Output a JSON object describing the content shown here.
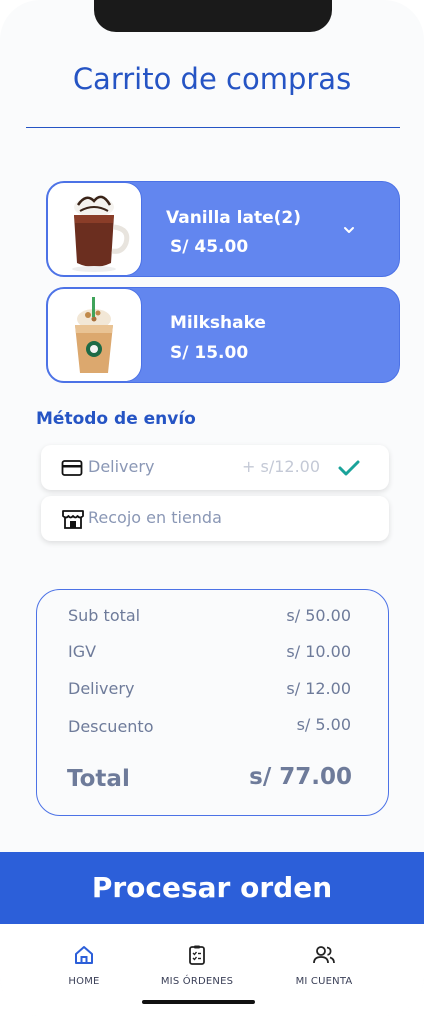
{
  "header": {
    "title": "Carrito de compras"
  },
  "cart": {
    "items": [
      {
        "name": "Vanilla late(2)",
        "price": "S/ 45.00",
        "icon": "hot-chocolate-mug-image"
      },
      {
        "name": "Milkshake",
        "price": "S/ 15.00",
        "icon": "frappuccino-cup-image"
      }
    ]
  },
  "shipping": {
    "label": "Método  de envío",
    "options": [
      {
        "label": "Delivery",
        "cost": "+ s/12.00",
        "icon": "credit-card-icon",
        "selected": true
      },
      {
        "label": "Recojo en tienda",
        "icon": "store-icon",
        "selected": false
      }
    ]
  },
  "summary": {
    "rows": [
      {
        "label": "Sub total",
        "value": "s/ 50.00"
      },
      {
        "label": "IGV",
        "value": "s/ 10.00"
      },
      {
        "label": "Delivery",
        "value": "s/ 12.00"
      },
      {
        "label": "Descuento",
        "value": "s/ 5.00"
      }
    ],
    "total_label": "Total",
    "total_value": "s/ 77.00"
  },
  "cta": {
    "label": "Procesar orden"
  },
  "tabbar": {
    "tabs": [
      {
        "label": "HOME",
        "icon": "home-icon",
        "active": true
      },
      {
        "label": "MIS ÓRDENES",
        "icon": "clipboard-icon",
        "active": false
      },
      {
        "label": "MI CUENTA",
        "icon": "users-icon",
        "active": false
      }
    ]
  },
  "colors": {
    "accent": "#2c5fd9",
    "card": "#6286ef",
    "title": "#2554c4",
    "check": "#1aa39a"
  }
}
